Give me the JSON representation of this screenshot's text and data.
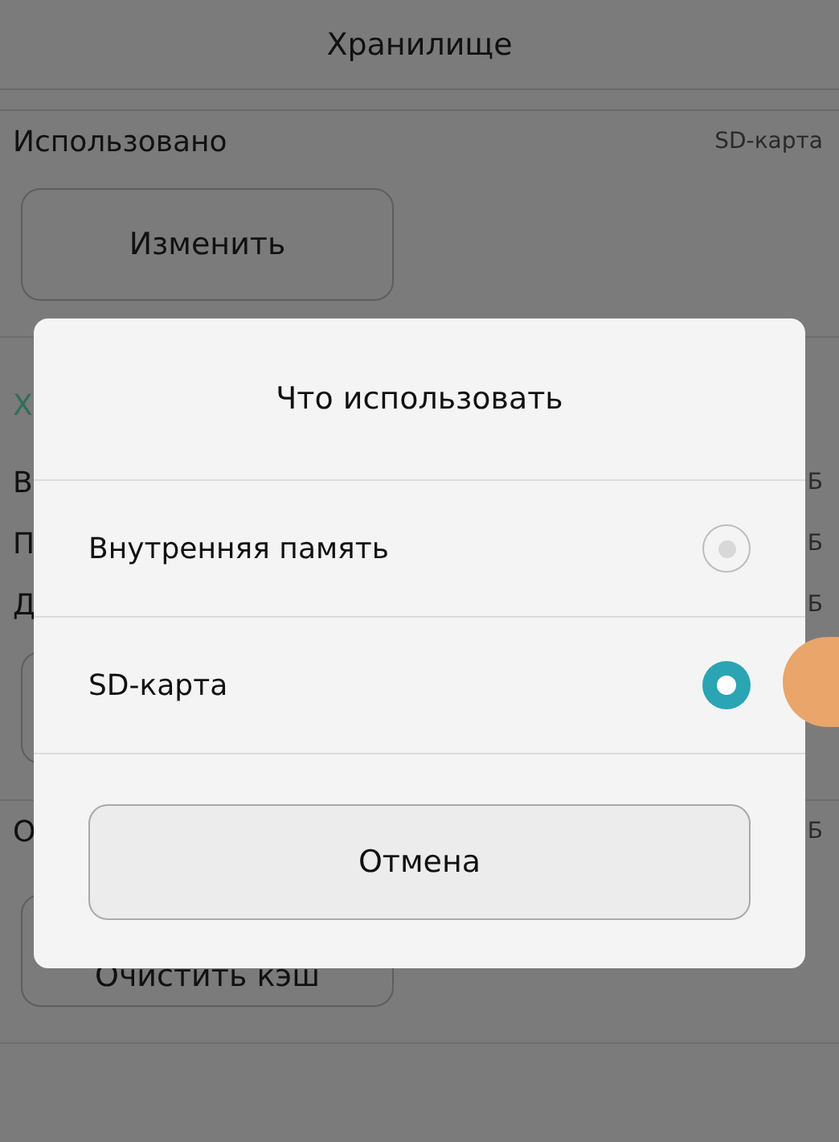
{
  "screen": {
    "title": "Хранилище",
    "items": [
      {
        "kind": "row",
        "label": "Использовано",
        "value": "SD-карта"
      },
      {
        "kind": "button",
        "label": "Изменить"
      },
      {
        "kind": "header",
        "label": "Х"
      },
      {
        "kind": "row",
        "label": "В",
        "value": "Б"
      },
      {
        "kind": "row",
        "label": "П",
        "value": "Б"
      },
      {
        "kind": "row",
        "label": "Д",
        "value": "Б"
      },
      {
        "kind": "button"
      },
      {
        "kind": "row",
        "label": "О",
        "value": "Б"
      },
      {
        "kind": "button",
        "label": "Очистить кэш"
      }
    ]
  },
  "dialog": {
    "title": "Что использовать",
    "options": [
      {
        "label": "Внутренняя память",
        "selected": false
      },
      {
        "label": "SD-карта",
        "selected": true
      }
    ],
    "cancel": "Отмена"
  }
}
